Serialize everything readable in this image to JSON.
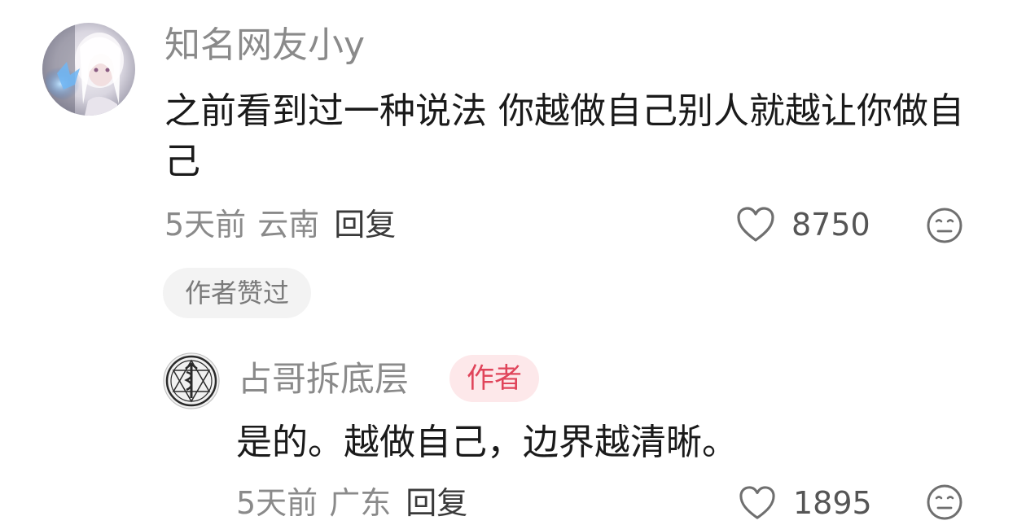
{
  "comment": {
    "username": "知名网友小y",
    "text": "之前看到过一种说法 你越做自己别人就越让你做自己",
    "time": "5天前",
    "location": "云南",
    "reply_label": "回复",
    "like_count": "8750",
    "author_liked_label": "作者赞过",
    "icons": {
      "avatar": "anime-avatar",
      "like": "heart-icon",
      "dislike": "dislike-face-icon"
    }
  },
  "reply": {
    "username": "占哥拆底层",
    "author_badge": "作者",
    "text": "是的。越做自己，边界越清晰。",
    "time": "5天前",
    "location": "广东",
    "reply_label": "回复",
    "like_count": "1895",
    "icons": {
      "avatar": "alchemy-emblem-avatar",
      "like": "heart-icon",
      "dislike": "dislike-face-icon"
    }
  },
  "colors": {
    "secondary_text": "#8a8a8a",
    "primary_text": "#1a1a1a",
    "author_badge_text": "#e0445a",
    "author_badge_bg": "#fde8ea",
    "chip_bg": "#f3f3f3"
  }
}
